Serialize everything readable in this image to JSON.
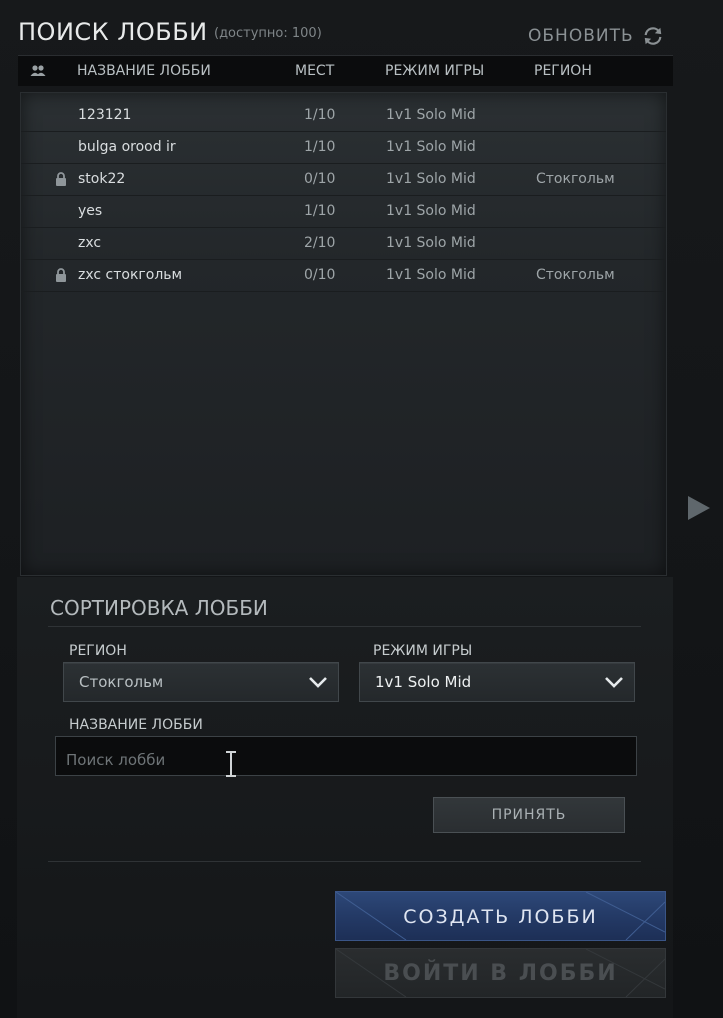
{
  "header": {
    "title": "ПОИСК ЛОББИ",
    "available_count": "(доступно: 100)",
    "refresh_label": "ОБНОВИТЬ"
  },
  "table": {
    "columns": {
      "name": "НАЗВАНИЕ ЛОББИ",
      "slots": "МЕСТ",
      "mode": "РЕЖИМ ИГРЫ",
      "region": "РЕГИОН"
    },
    "rows": [
      {
        "name": "123121",
        "slots": "1/10",
        "mode": "1v1 Solo Mid",
        "region": "",
        "locked": false
      },
      {
        "name": "bulga orood ir",
        "slots": "1/10",
        "mode": "1v1 Solo Mid",
        "region": "",
        "locked": false
      },
      {
        "name": "stok22",
        "slots": "0/10",
        "mode": "1v1 Solo Mid",
        "region": "Стокгольм",
        "locked": true
      },
      {
        "name": "yes",
        "slots": "1/10",
        "mode": "1v1 Solo Mid",
        "region": "",
        "locked": false
      },
      {
        "name": "zxc",
        "slots": "2/10",
        "mode": "1v1 Solo Mid",
        "region": "",
        "locked": false
      },
      {
        "name": "zxc стокгольм",
        "slots": "0/10",
        "mode": "1v1 Solo Mid",
        "region": "Стокгольм",
        "locked": true
      }
    ]
  },
  "filters": {
    "title": "СОРТИРОВКА ЛОББИ",
    "region_label": "РЕГИОН",
    "region_value": "Стокгольм",
    "mode_label": "РЕЖИМ ИГРЫ",
    "mode_value": "1v1 Solo Mid",
    "name_label": "НАЗВАНИЕ ЛОББИ",
    "name_placeholder": "Поиск лобби",
    "accept_label": "ПРИНЯТЬ"
  },
  "actions": {
    "create_label": "СОЗДАТЬ ЛОББИ",
    "join_label": "ВОЙТИ В ЛОББИ"
  },
  "icons": {
    "refresh": "refresh-icon",
    "players": "players-icon",
    "lock": "lock-icon",
    "chevron": "chevron-down-icon",
    "side_arrow": "arrow-right-icon",
    "text_cursor": "text-cursor-icon"
  },
  "colors": {
    "create_button": "#243a66",
    "join_button_disabled": "#2a2d2f",
    "background": "#141618"
  }
}
